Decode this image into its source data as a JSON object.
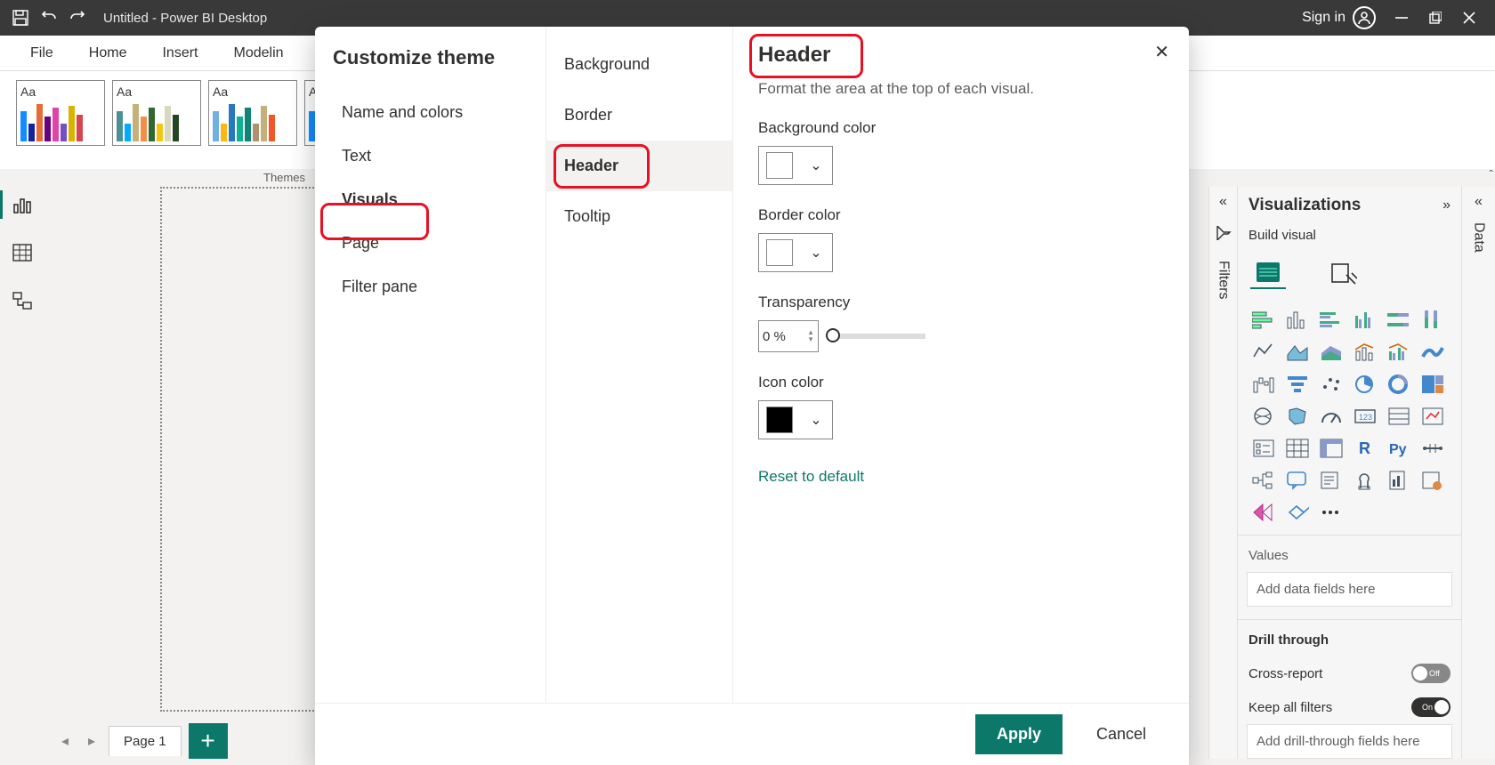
{
  "titlebar": {
    "title": "Untitled - Power BI Desktop",
    "signin": "Sign in"
  },
  "ribbon": {
    "file": "File",
    "home": "Home",
    "insert": "Insert",
    "modeling": "Modelin"
  },
  "themes_label": "Themes",
  "page": {
    "tab": "Page 1"
  },
  "dialog": {
    "title": "Customize theme",
    "nav": {
      "name_colors": "Name and colors",
      "text": "Text",
      "visuals": "Visuals",
      "page": "Page",
      "filter_pane": "Filter pane"
    },
    "sub": {
      "background": "Background",
      "border": "Border",
      "header": "Header",
      "tooltip": "Tooltip"
    },
    "detail": {
      "heading": "Header",
      "desc": "Format the area at the top of each visual.",
      "bgcolor": "Background color",
      "bordercolor": "Border color",
      "transparency": "Transparency",
      "trans_val": "0 %",
      "iconcolor": "Icon color",
      "reset": "Reset to default"
    },
    "footer": {
      "apply": "Apply",
      "cancel": "Cancel"
    }
  },
  "viz": {
    "title": "Visualizations",
    "build": "Build visual",
    "values": "Values",
    "values_drop": "Add data fields here",
    "drill": "Drill through",
    "cross": "Cross-report",
    "keep": "Keep all filters",
    "drill_drop": "Add drill-through fields here",
    "off": "Off",
    "on": "On"
  },
  "filters_label": "Filters",
  "data_label": "Data"
}
